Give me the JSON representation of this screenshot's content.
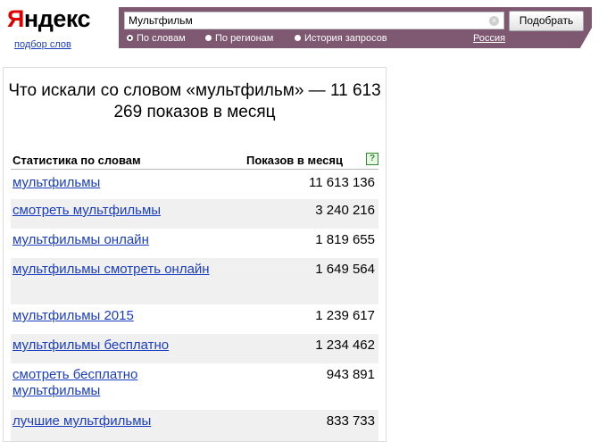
{
  "brand": {
    "logo_first": "Я",
    "logo_rest": "ндекс",
    "sublink": "подбор слов"
  },
  "search": {
    "query": "Мультфильм",
    "clear_icon": "close-circle-icon",
    "submit_label": "Подобрать",
    "modes": [
      {
        "label": "По словам",
        "selected": true
      },
      {
        "label": "По регионам",
        "selected": false
      },
      {
        "label": "История запросов",
        "selected": false
      }
    ],
    "region": "Россия"
  },
  "results": {
    "title": "Что искали со словом «мультфильм» — 11 613 269 показов в месяц",
    "col_word": "Статистика по словам",
    "col_count": "Показов в месяц",
    "help_icon": "?",
    "rows": [
      {
        "phrase": "мультфильмы",
        "count": "11 613 136"
      },
      {
        "phrase": "смотреть мультфильмы",
        "count": "3 240 216"
      },
      {
        "phrase": "мультфильмы онлайн",
        "count": "1 819 655"
      },
      {
        "phrase": "мультфильмы смотреть онлайн",
        "count": "1 649 564"
      },
      {
        "phrase": "мультфильмы 2015",
        "count": "1 239 617"
      },
      {
        "phrase": "мультфильмы бесплатно",
        "count": "1 234 462"
      },
      {
        "phrase": "смотреть бесплатно мультфильмы",
        "count": "943 891"
      },
      {
        "phrase": "лучшие мультфильмы",
        "count": "833 733"
      }
    ]
  },
  "colors": {
    "header_bar": "#7e5770",
    "link": "#1a3dc1",
    "logo_red": "#e00000"
  }
}
